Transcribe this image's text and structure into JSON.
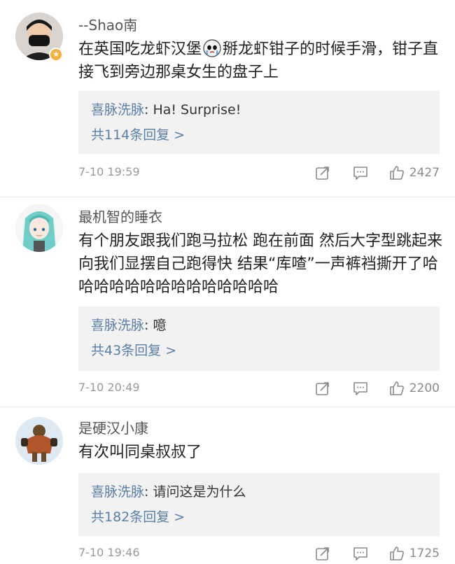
{
  "comments": [
    {
      "username": "--Shao南",
      "content_before_emoji": "在英国吃龙虾汉堡",
      "content_after_emoji": "掰龙虾钳子的时候手滑，钳子直接飞到旁边那桌女生的盘子上",
      "emoji_icon": "crying-face-emoji",
      "reply": {
        "name": "喜脉洗脉",
        "text": "Ha! Surprise!",
        "more": "共114条回复 >"
      },
      "time": "7-10 19:59",
      "likes": "2427"
    },
    {
      "username": "最机智的睡衣",
      "content": "有个朋友跟我们跑马拉松 跑在前面 然后大字型跳起来向我们显摆自己跑得快 结果“库喳”一声裤裆撕开了哈哈哈哈哈哈哈哈哈哈哈哈哈哈",
      "reply": {
        "name": "喜脉洗脉",
        "text": "噫",
        "more": "共43条回复 >"
      },
      "time": "7-10 20:49",
      "likes": "2200"
    },
    {
      "username": "是硬汉小康",
      "content": "有次叫同桌叔叔了",
      "reply": {
        "name": "喜脉洗脉",
        "text": "请问这是为什么",
        "more": "共182条回复 >"
      },
      "time": "7-10 19:46",
      "likes": "1725"
    }
  ],
  "colors": {
    "link": "#5a7fa8",
    "reply_bg": "#f2f2f2",
    "badge": "#f7b13a",
    "meta": "#9a9a9a"
  },
  "icons": {
    "share": "share-icon",
    "comment": "comment-icon",
    "like": "thumbs-up-icon",
    "badge": "verified-badge-icon"
  }
}
